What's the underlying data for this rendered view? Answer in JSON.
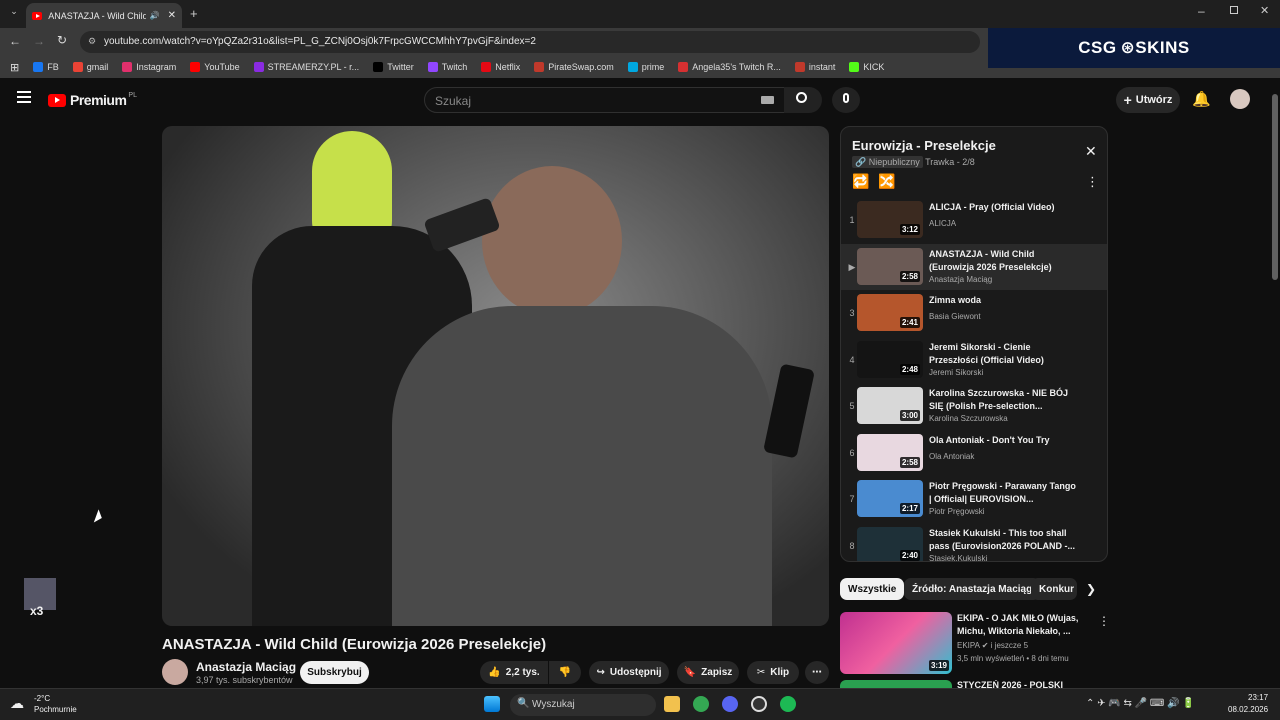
{
  "browser": {
    "tab_title": "ANASTAZJA - Wild Child (E",
    "url": "youtube.com/watch?v=oYpQZa2r31o&list=PL_G_ZCNj0Osj0k7FrpcGWCCMhhY7pvGjF&index=2",
    "bookmarks": [
      "FB",
      "gmail",
      "Instagram",
      "YouTube",
      "STREAMERZY.PL - r...",
      "Twitter",
      "Twitch",
      "Netflix",
      "PirateSwap.com",
      "prime",
      "Angela35's Twitch R...",
      "instant",
      "KICK"
    ],
    "bookmark_colors": [
      "#1877f2",
      "#ea4335",
      "#e1306c",
      "#ff0000",
      "#8a2be2",
      "#000000",
      "#9146ff",
      "#e50914",
      "#c0392b",
      "#00a8e1",
      "#d63031",
      "#c0392b",
      "#53fc18"
    ]
  },
  "ad": {
    "text": "CSG ⊛SKINS"
  },
  "youtube": {
    "logo_text": "Premium",
    "region": "PL",
    "search_placeholder": "Szukaj",
    "create_label": "Utwórz"
  },
  "video": {
    "title": "ANASTAZJA - Wild Child (Eurowizja 2026 Preselekcje)",
    "channel": "Anastazja Maciąg",
    "subscribers": "3,97 tys. subskrybentów",
    "subscribe_label": "Subskrybuj",
    "likes": "2,2 tys.",
    "share_label": "Udostępnij",
    "save_label": "Zapisz",
    "clip_label": "Klip"
  },
  "playlist": {
    "title": "Eurowizja - Preselekcje",
    "visibility": "Niepubliczny",
    "owner_progress": "Trawka - 2/8",
    "items": [
      {
        "index": "1",
        "title": "ALICJA - Pray (Official Video)",
        "channel": "ALICJA",
        "duration": "3:12",
        "thumb": "#3b2a20"
      },
      {
        "index": "▶",
        "title": "ANASTAZJA - Wild Child (Eurowizja 2026 Preselekcje)",
        "channel": "Anastazja Maciąg",
        "duration": "2:58",
        "thumb": "#6b5a55"
      },
      {
        "index": "3",
        "title": "Zimna woda",
        "channel": "Basia Giewont",
        "duration": "2:41",
        "thumb": "#b5562c"
      },
      {
        "index": "4",
        "title": "Jeremi Sikorski - Cienie Przeszłości (Official Video)",
        "channel": "Jeremi Sikorski",
        "duration": "2:48",
        "thumb": "#141414"
      },
      {
        "index": "5",
        "title": "Karolina Szczurowska - NIE BÓJ SIĘ (Polish Pre-selection...",
        "channel": "Karolina Szczurowska",
        "duration": "3:00",
        "thumb": "#d8d8d8"
      },
      {
        "index": "6",
        "title": "Ola Antoniak - Don't You Try",
        "channel": "Ola Antoniak",
        "duration": "2:58",
        "thumb": "#e8d8e0"
      },
      {
        "index": "7",
        "title": "Piotr Pręgowski - Parawany Tango | Official| EUROVISION...",
        "channel": "Piotr Pręgowski",
        "duration": "2:17",
        "thumb": "#4a8bd0"
      },
      {
        "index": "8",
        "title": "Stasiek Kukulski - This too shall pass (Eurovision2026 POLAND -...",
        "channel": "Stasiek.Kukulski",
        "duration": "2:40",
        "thumb": "#1e3038"
      }
    ]
  },
  "chips": [
    "Wszystkie",
    "Źródło: Anastazja Maciąg",
    "Konkur"
  ],
  "recommendations": [
    {
      "title": "EKIPA - O JAK MIŁO (Wujas, Michu, Wiktoria Niekało, ...",
      "channel": "EKIPA",
      "extra": "i jeszcze 5",
      "meta": "3,5 mln wyświetleń • 8 dni temu",
      "duration": "3:19"
    },
    {
      "title": "STYCZEŃ 2026 - POLSKI",
      "channel": "",
      "extra": "",
      "meta": "",
      "duration": ""
    }
  ],
  "overlay": {
    "badge": "x3"
  },
  "taskbar": {
    "weather_temp": "-2°C",
    "weather_desc": "Pochmurnie",
    "search_label": "Wyszukaj",
    "time": "23:17",
    "date": "08.02.2026"
  }
}
